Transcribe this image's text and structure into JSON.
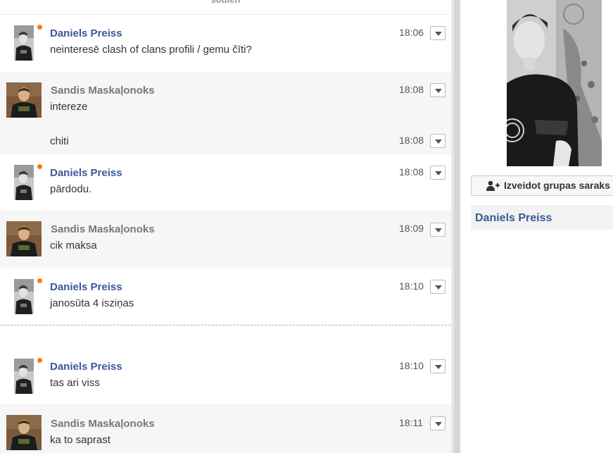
{
  "chat": {
    "date_label": "šodien",
    "messages": [
      {
        "author": "Daniels Preiss",
        "time": "18:06",
        "text": "neinteresē clash of clans profili / gemu čīti?"
      },
      {
        "author": "Sandis Maskaļonoks",
        "time": "18:08",
        "text": "intereze"
      },
      {
        "author": "",
        "time": "18:08",
        "text": "chiti"
      },
      {
        "author": "Daniels Preiss",
        "time": "18:08",
        "text": "pārdodu."
      },
      {
        "author": "Sandis Maskaļonoks",
        "time": "18:09",
        "text": "cik maksa"
      },
      {
        "author": "Daniels Preiss",
        "time": "18:10",
        "text": "janosūta 4 isziņas"
      },
      {
        "author": "Daniels Preiss",
        "time": "18:10",
        "text": "tas ari viss"
      },
      {
        "author": "Sandis Maskaļonoks",
        "time": "18:11",
        "text": "ka to saprast"
      }
    ]
  },
  "sidebar": {
    "group_button_label": "Izveidot grupas saraks",
    "contact_name": "Daniels Preiss"
  },
  "icons": {
    "menu": "chevron-down-icon",
    "group": "add-user-icon",
    "online": "online-status-icon"
  },
  "colors": {
    "author_link": "#3b5998",
    "online_dot": "#f27c1a",
    "alt_row": "#f6f6f6"
  }
}
